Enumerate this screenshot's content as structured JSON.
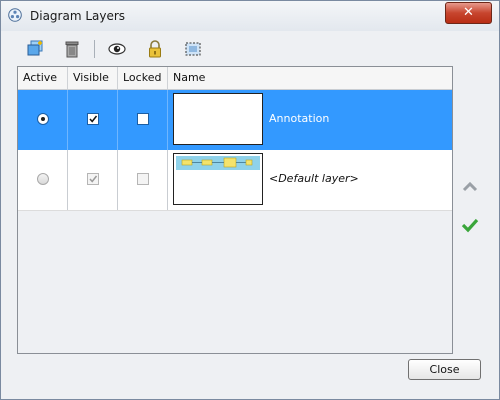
{
  "window": {
    "title": "Diagram Layers",
    "close_glyph": "✕"
  },
  "toolbar": {
    "icons": [
      "new-layer-icon",
      "trash-icon",
      "eye-icon",
      "lock-icon",
      "select-box-icon"
    ]
  },
  "table": {
    "columns": [
      "Active",
      "Visible",
      "Locked",
      "Name"
    ],
    "rows": [
      {
        "name": "Annotation",
        "active": true,
        "visible": true,
        "locked": false,
        "selected": true
      },
      {
        "name": "<Default layer>",
        "active": false,
        "visible": true,
        "locked": false,
        "selected": false
      }
    ]
  },
  "side": {
    "icons": [
      "chevron-up-icon",
      "checkmark-icon"
    ]
  },
  "footer": {
    "close_label": "Close"
  },
  "colors": {
    "selection": "#3399ff",
    "accept_green": "#3aa63a",
    "close_red": "#c7452e"
  }
}
